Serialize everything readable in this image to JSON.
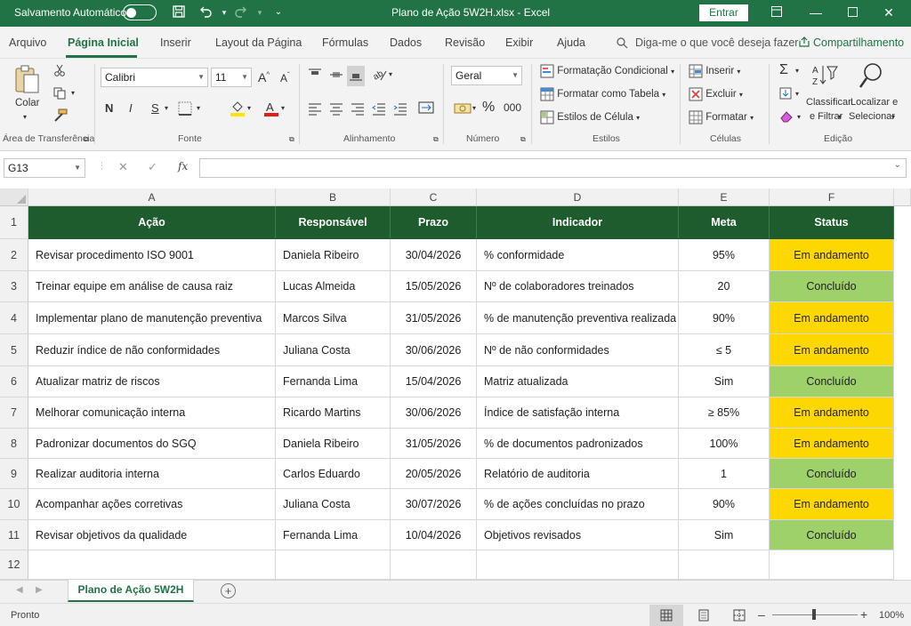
{
  "titlebar": {
    "autosave_label": "Salvamento Automático",
    "document_title": "Plano de Ação 5W2H.xlsx  -  Excel",
    "signin_label": "Entrar",
    "accent": "#217346"
  },
  "menu": {
    "tabs": [
      "Arquivo",
      "Página Inicial",
      "Inserir",
      "Layout da Página",
      "Fórmulas",
      "Dados",
      "Revisão",
      "Exibir",
      "Ajuda"
    ],
    "tell_me": "Diga-me o que você deseja fazer",
    "share": "Compartilhamento"
  },
  "ribbon": {
    "clipboard": {
      "paste_label": "Colar",
      "group_label": "Área de Transferência"
    },
    "font": {
      "name": "Calibri",
      "size": "11",
      "bold": "N",
      "italic": "I",
      "underline": "S",
      "group_label": "Fonte"
    },
    "alignment": {
      "group_label": "Alinhamento"
    },
    "number": {
      "format": "Geral",
      "group_label": "Número"
    },
    "styles": {
      "conditional": "Formatação Condicional",
      "table": "Formatar como Tabela",
      "cell_styles": "Estilos de Célula",
      "group_label": "Estilos"
    },
    "cells": {
      "insert": "Inserir",
      "delete": "Excluir",
      "format": "Formatar",
      "group_label": "Células"
    },
    "editing": {
      "sort_1": "Classificar",
      "sort_2": "e Filtrar",
      "find_1": "Localizar e",
      "find_2": "Selecionar",
      "group_label": "Edição"
    }
  },
  "formula_bar": {
    "name_box": "G13",
    "fx": "fx",
    "value": ""
  },
  "columns": [
    "A",
    "B",
    "C",
    "D",
    "E",
    "F"
  ],
  "rows": [
    "1",
    "2",
    "3",
    "4",
    "5",
    "6",
    "7",
    "8",
    "9",
    "10",
    "11",
    "12"
  ],
  "table": {
    "headers": [
      "Ação",
      "Responsável",
      "Prazo",
      "Indicador",
      "Meta",
      "Status"
    ],
    "records": [
      [
        "Revisar procedimento ISO 9001",
        "Daniela Ribeiro",
        "30/04/2026",
        "% conformidade",
        "95%",
        "Em andamento"
      ],
      [
        "Treinar equipe em análise de causa raiz",
        "Lucas Almeida",
        "15/05/2026",
        "Nº de colaboradores treinados",
        "20",
        "Concluído"
      ],
      [
        "Implementar plano de manutenção preventiva",
        "Marcos Silva",
        "31/05/2026",
        "% de manutenção preventiva realizada",
        "90%",
        "Em andamento"
      ],
      [
        "Reduzir índice de não conformidades",
        "Juliana Costa",
        "30/06/2026",
        "Nº de não conformidades",
        "≤ 5",
        "Em andamento"
      ],
      [
        "Atualizar matriz de riscos",
        "Fernanda Lima",
        "15/04/2026",
        "Matriz atualizada",
        "Sim",
        "Concluído"
      ],
      [
        "Melhorar comunicação interna",
        "Ricardo Martins",
        "30/06/2026",
        "Índice de satisfação interna",
        "≥ 85%",
        "Em andamento"
      ],
      [
        "Padronizar documentos do SGQ",
        "Daniela Ribeiro",
        "31/05/2026",
        "% de documentos padronizados",
        "100%",
        "Em andamento"
      ],
      [
        "Realizar auditoria interna",
        "Carlos Eduardo",
        "20/05/2026",
        "Relatório de auditoria",
        "1",
        "Concluído"
      ],
      [
        "Acompanhar ações corretivas",
        "Juliana Costa",
        "30/07/2026",
        "% de ações concluídas no prazo",
        "90%",
        "Em andamento"
      ],
      [
        "Revisar objetivos da qualidade",
        "Fernanda Lima",
        "10/04/2026",
        "Objetivos revisados",
        "Sim",
        "Concluído"
      ]
    ],
    "colors": {
      "header": "#1e5c2e",
      "in_progress": "#fdd800",
      "done": "#9fd16a"
    }
  },
  "sheet_tabs": {
    "active": "Plano de Ação 5W2H"
  },
  "status_bar": {
    "status": "Pronto",
    "zoom": "100%"
  }
}
